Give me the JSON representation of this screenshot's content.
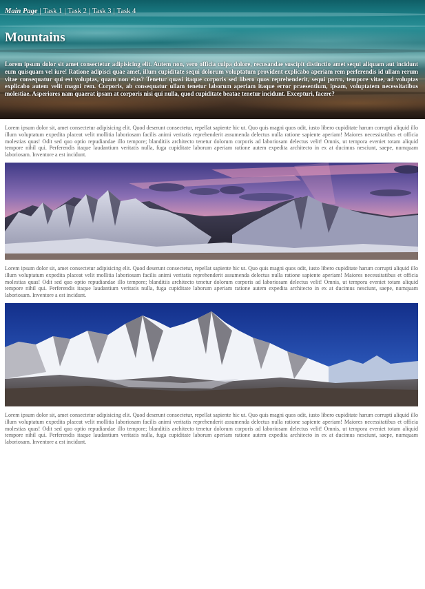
{
  "nav": {
    "main_label": "Main Page",
    "separator": "|",
    "task1_label": "Task 1",
    "task2_label": "Task 2",
    "task3_label": "Task 3",
    "task4_label": "Task 4"
  },
  "hero": {
    "title": "Mountains",
    "text": "Lorem ipsum dolor sit amet consectetur adipisicing elit. Autem non, vero officia culpa dolore, recusandae suscipit distinctio amet sequi aliquam aut incidunt eum quisquam vel iure! Ratione adipisci quae amet, illum cupiditate sequi dolorum voluptatum provident explicabo aperiam rem perferendis id ullam rerum vitae consequatur qui est voluptas, quam non eius? Tenetur quasi itaque corporis sed libero quos reprehenderit, sequi porro, tempore vitae, ad voluptas explicabo autem velit magni rem. Corporis, ab consequatur ullam tenetur laborum aperiam itaque error praesentium, ipsam, voluptatem necessitatibus molestiae. Asperiores nam quaerat ipsam at corporis nisi qui nulla, quod cupiditate beatae tenetur incidunt. Excepturi, facere?"
  },
  "content": {
    "paragraph_1": "Lorem ipsum dolor sit, amet consectetur adipisicing elit. Quod deserunt consectetur, repellat sapiente hic ut. Quo quis magni quos odit, iusto libero cupiditate harum corrupti aliquid illo illum voluptatum expedita placeat velit mollitia laboriosam facilis animi veritatis reprehenderit assumenda delectus nulla ratione sapiente aperiam! Maiores necessitatibus et officia molestias quas! Odit sed quo optio repudiandae illo tempore; blanditiis architecto tenetur dolorum corporis ad laboriosam delectus velit! Omnis, ut tempora eveniet totam aliquid tempore nihil qui. Perferendis itaque laudantium veritatis nulla, fuga cupiditate laborum aperiam ratione autem expedita architecto in ex at ducimus nesciunt, saepe, numquam laboriosam. Inventore a est incidunt.",
    "paragraph_2": "Lorem ipsum dolor sit, amet consectetur adipisicing elit. Quod deserunt consectetur, repellat sapiente hic ut. Quo quis magni quos odit, iusto libero cupiditate harum corrupti aliquid illo illum voluptatum expedita placeat velit mollitia laboriosam facilis animi veritatis reprehenderit assumenda delectus nulla ratione sapiente aperiam! Maiores necessitatibus et officia molestias quas! Odit sed quo optio repudiandae illo tempore; blanditiis architecto tenetur dolorum corporis ad laboriosam delectus velit! Omnis, ut tempora eveniet totam aliquid tempore nihil qui. Perferendis itaque laudantium veritatis nulla, fuga cupiditate laborum aperiam ratione autem expedita architecto in ex at ducimus nesciunt, saepe, numquam laboriosam. Inventore a est incidunt.",
    "paragraph_3": "Lorem ipsum dolor sit, amet consectetur adipisicing elit. Quod deserunt consectetur, repellat sapiente hic ut. Quo quis magni quos odit, iusto libero cupiditate harum corrupti aliquid illo illum voluptatum expedita placeat velit mollitia laboriosam facilis animi veritatis reprehenderit assumenda delectus nulla ratione sapiente aperiam! Maiores necessitatibus et officia molestias quas! Odit sed quo optio repudiandae illo tempore; blanditiis architecto tenetur dolorum corporis ad laboriosam delectus velit! Omnis, ut tempora eveniet totam aliquid tempore nihil qui. Perferendis itaque laudantium veritatis nulla, fuga cupiditate laborum aperiam ratione autem expedita architecto in ex at ducimus nesciunt, saepe, numquam laboriosam. Inventore a est incidunt."
  },
  "colors": {
    "hero_teal": "#1d8189",
    "hero_brown": "#4a3526",
    "body_text": "#5a5a5a",
    "sunset_pink": "#e27fa0",
    "sky_blue": "#1d3f9a"
  }
}
